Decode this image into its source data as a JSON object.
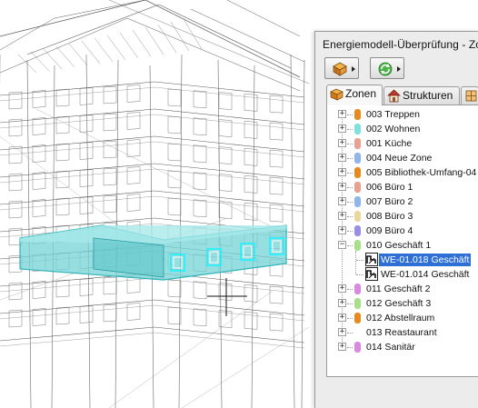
{
  "panel": {
    "title": "Energiemodell-Überprüfung - Zo",
    "toolbar": [
      {
        "icon": "model-review-icon",
        "has_menu": true
      },
      {
        "icon": "refresh-icon",
        "has_menu": true
      }
    ],
    "tabs": [
      {
        "label": "Zonen",
        "icon": "zones-icon",
        "active": true
      },
      {
        "label": "Strukturen",
        "icon": "structures-icon",
        "active": false
      },
      {
        "label": "",
        "icon": "openings-icon",
        "active": false
      }
    ]
  },
  "tree": {
    "items": [
      {
        "label": "003 Treppen",
        "color": "#e58a1e",
        "expanded": false
      },
      {
        "label": "002 Wohnen",
        "color": "#7fe0dc",
        "expanded": false
      },
      {
        "label": "001 Küche",
        "color": "#e8a190",
        "expanded": false
      },
      {
        "label": "004 Neue Zone",
        "color": "#8fb6e8",
        "expanded": false
      },
      {
        "label": "005 Bibliothek-Umfang-04",
        "color": "#e58a1e",
        "expanded": false
      },
      {
        "label": "006 Büro 1",
        "color": "#e8a190",
        "expanded": false
      },
      {
        "label": "007 Büro 2",
        "color": "#8fb6e8",
        "expanded": false
      },
      {
        "label": "008 Büro 3",
        "color": "#e8d99a",
        "expanded": false
      },
      {
        "label": "009 Büro 4",
        "color": "#9a8de8",
        "expanded": false
      },
      {
        "label": "010 Geschäft 1",
        "color": "#a8e08a",
        "expanded": true,
        "children": [
          {
            "label": "WE-01.018 Geschäft",
            "selected": true
          },
          {
            "label": "WE-01.014 Geschäft",
            "selected": false
          }
        ]
      },
      {
        "label": "011 Geschäft 2",
        "color": "#d88ae0",
        "expanded": false
      },
      {
        "label": "012 Geschäft 3",
        "color": "#a8e08a",
        "expanded": false
      },
      {
        "label": "012 Abstellraum",
        "color": "#e58a1e",
        "expanded": false
      },
      {
        "label": "013 Reastaurant",
        "color": "",
        "expanded": false
      },
      {
        "label": "014 Sanitär",
        "color": "#d88ae0",
        "expanded": false
      }
    ]
  }
}
